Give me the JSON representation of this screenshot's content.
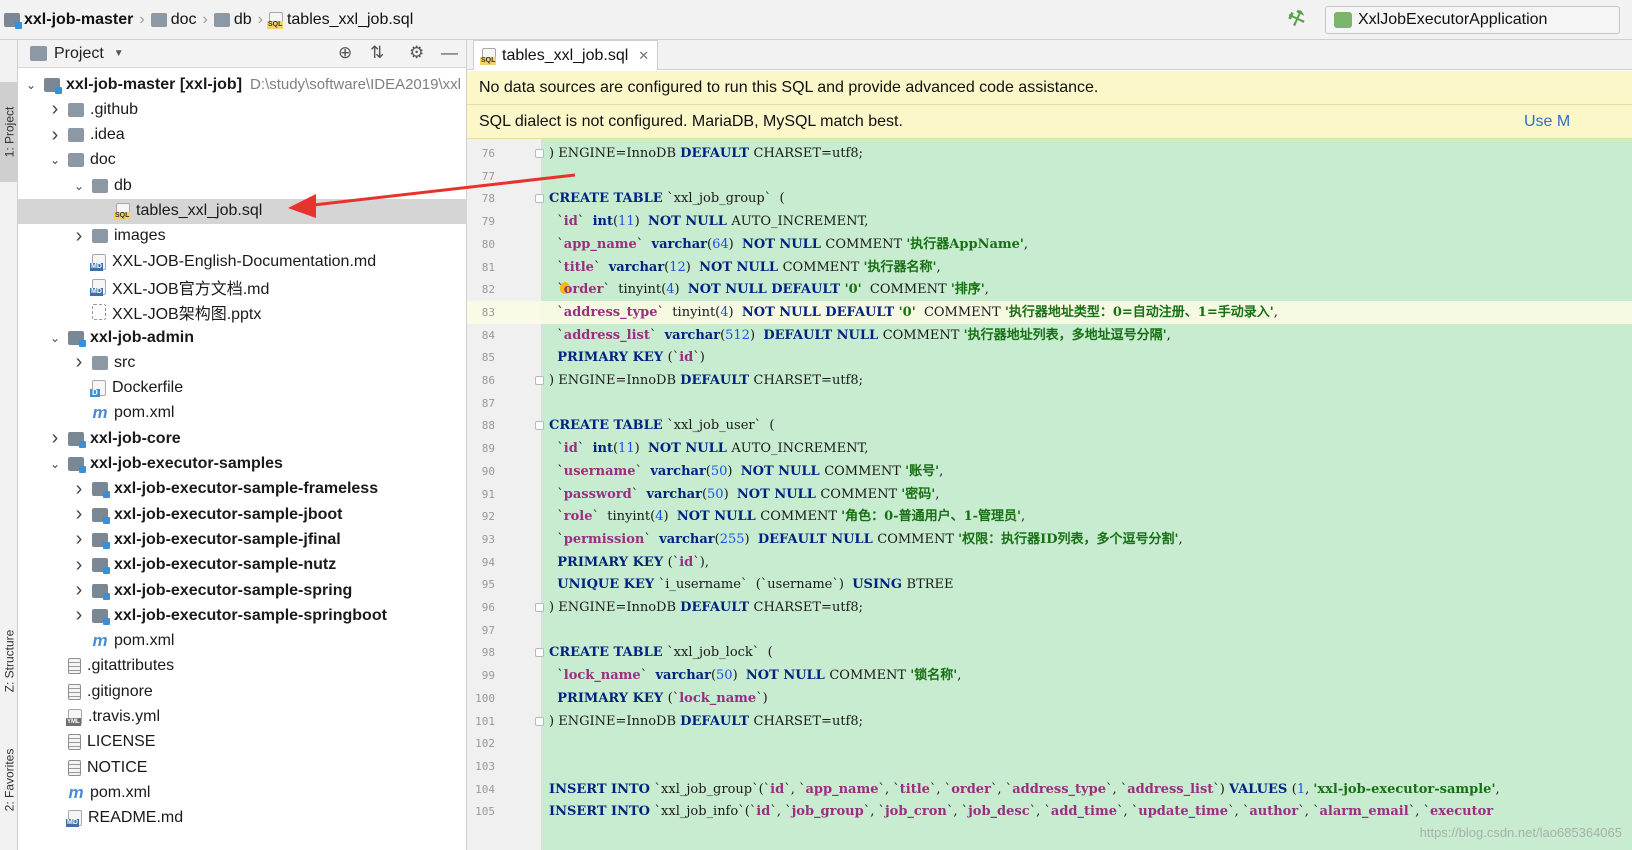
{
  "breadcrumb": [
    {
      "label": "xxl-job-master",
      "icon": "project-folder-icon",
      "bold": true
    },
    {
      "label": "doc",
      "icon": "folder-icon",
      "bold": false
    },
    {
      "label": "db",
      "icon": "folder-icon",
      "bold": false
    },
    {
      "label": "tables_xxl_job.sql",
      "icon": "sql-file-icon",
      "bold": false
    }
  ],
  "run_config": {
    "label": "XxlJobExecutorApplication",
    "icon": "spring-boot-run-icon"
  },
  "build_icon": "hammer-icon",
  "left_tool_tabs": [
    "1: Project",
    "Z: Structure",
    "2: Favorites"
  ],
  "project_panel": {
    "title": "Project"
  },
  "tree": [
    {
      "depth": 0,
      "arrow": "down",
      "icon": "folder mod",
      "label": "xxl-job-master [xxl-job]",
      "bold": true,
      "path": "D:\\study\\software\\IDEA2019\\xxl"
    },
    {
      "depth": 1,
      "arrow": "right",
      "icon": "folder",
      "label": ".github"
    },
    {
      "depth": 1,
      "arrow": "right",
      "icon": "folder",
      "label": ".idea"
    },
    {
      "depth": 1,
      "arrow": "down",
      "icon": "folder",
      "label": "doc"
    },
    {
      "depth": 2,
      "arrow": "down",
      "icon": "folder",
      "label": "db"
    },
    {
      "depth": 3,
      "arrow": "",
      "icon": "sql",
      "label": "tables_xxl_job.sql",
      "selected": true
    },
    {
      "depth": 2,
      "arrow": "right",
      "icon": "folder",
      "label": "images"
    },
    {
      "depth": 2,
      "arrow": "",
      "icon": "md",
      "label": "XXL-JOB-English-Documentation.md"
    },
    {
      "depth": 2,
      "arrow": "",
      "icon": "md",
      "label": "XXL-JOB官方文档.md"
    },
    {
      "depth": 2,
      "arrow": "",
      "icon": "ppt",
      "label": "XXL-JOB架构图.pptx"
    },
    {
      "depth": 1,
      "arrow": "down",
      "icon": "folder mod",
      "label": "xxl-job-admin",
      "bold": true
    },
    {
      "depth": 2,
      "arrow": "right",
      "icon": "folder",
      "label": "src"
    },
    {
      "depth": 2,
      "arrow": "",
      "icon": "docker",
      "label": "Dockerfile"
    },
    {
      "depth": 2,
      "arrow": "",
      "icon": "maven",
      "label": "pom.xml"
    },
    {
      "depth": 1,
      "arrow": "right",
      "icon": "folder mod",
      "label": "xxl-job-core",
      "bold": true
    },
    {
      "depth": 1,
      "arrow": "down",
      "icon": "folder mod",
      "label": "xxl-job-executor-samples",
      "bold": true
    },
    {
      "depth": 2,
      "arrow": "right",
      "icon": "folder mod",
      "label": "xxl-job-executor-sample-frameless",
      "bold": true
    },
    {
      "depth": 2,
      "arrow": "right",
      "icon": "folder mod",
      "label": "xxl-job-executor-sample-jboot",
      "bold": true
    },
    {
      "depth": 2,
      "arrow": "right",
      "icon": "folder mod",
      "label": "xxl-job-executor-sample-jfinal",
      "bold": true
    },
    {
      "depth": 2,
      "arrow": "right",
      "icon": "folder mod",
      "label": "xxl-job-executor-sample-nutz",
      "bold": true
    },
    {
      "depth": 2,
      "arrow": "right",
      "icon": "folder mod",
      "label": "xxl-job-executor-sample-spring",
      "bold": true
    },
    {
      "depth": 2,
      "arrow": "right",
      "icon": "folder mod",
      "label": "xxl-job-executor-sample-springboot",
      "bold": true
    },
    {
      "depth": 2,
      "arrow": "",
      "icon": "maven",
      "label": "pom.xml"
    },
    {
      "depth": 1,
      "arrow": "",
      "icon": "txt",
      "label": ".gitattributes"
    },
    {
      "depth": 1,
      "arrow": "",
      "icon": "txt",
      "label": ".gitignore"
    },
    {
      "depth": 1,
      "arrow": "",
      "icon": "yml",
      "label": ".travis.yml"
    },
    {
      "depth": 1,
      "arrow": "",
      "icon": "txt",
      "label": "LICENSE"
    },
    {
      "depth": 1,
      "arrow": "",
      "icon": "txt",
      "label": "NOTICE"
    },
    {
      "depth": 1,
      "arrow": "",
      "icon": "maven",
      "label": "pom.xml"
    },
    {
      "depth": 1,
      "arrow": "",
      "icon": "md",
      "label": "README.md"
    }
  ],
  "editor": {
    "tab_label": "tables_xxl_job.sql",
    "banner1": "No data sources are configured to run this SQL and provide advanced code assistance.",
    "banner2": "SQL dialect is not configured. MariaDB, MySQL match best.",
    "banner2_link": "Use M",
    "current_line": 83,
    "lines": [
      {
        "n": "76",
        "fold": true,
        "t": [
          [
            ") ENGINE=InnoDB ",
            ""
          ],
          [
            "DEFAULT ",
            "kw"
          ],
          [
            "CHARSET=utf8;",
            ""
          ]
        ]
      },
      {
        "n": "77",
        "t": []
      },
      {
        "n": "78",
        "fold": true,
        "t": [
          [
            "CREATE TABLE ",
            "kw"
          ],
          [
            "`xxl_job_group`  (",
            ""
          ]
        ]
      },
      {
        "n": "79",
        "t": [
          [
            "  `",
            ""
          ],
          [
            "id",
            "id"
          ],
          [
            "`  ",
            ""
          ],
          [
            "int",
            "kw"
          ],
          [
            "(",
            ""
          ],
          [
            "11",
            "num"
          ],
          [
            ")  ",
            ""
          ],
          [
            "NOT NULL ",
            "kw"
          ],
          [
            "AUTO_INCREMENT,",
            ""
          ]
        ]
      },
      {
        "n": "80",
        "t": [
          [
            "  `",
            ""
          ],
          [
            "app_name",
            "id"
          ],
          [
            "`  ",
            ""
          ],
          [
            "varchar",
            "kw"
          ],
          [
            "(",
            ""
          ],
          [
            "64",
            "num"
          ],
          [
            ")  ",
            ""
          ],
          [
            "NOT NULL ",
            "kw"
          ],
          [
            "COMMENT ",
            ""
          ],
          [
            "'执行器AppName'",
            "str"
          ],
          [
            ",",
            ""
          ]
        ]
      },
      {
        "n": "81",
        "t": [
          [
            "  `",
            ""
          ],
          [
            "title",
            "id"
          ],
          [
            "`  ",
            ""
          ],
          [
            "varchar",
            "kw"
          ],
          [
            "(",
            ""
          ],
          [
            "12",
            "num"
          ],
          [
            ")  ",
            ""
          ],
          [
            "NOT NULL ",
            "kw"
          ],
          [
            "COMMENT ",
            ""
          ],
          [
            "'执行器名称'",
            "str"
          ],
          [
            ",",
            ""
          ]
        ]
      },
      {
        "n": "82",
        "bulb": true,
        "t": [
          [
            "  `",
            ""
          ],
          [
            "order",
            "id"
          ],
          [
            "`  tinyint(",
            ""
          ],
          [
            "4",
            "num"
          ],
          [
            ")  ",
            ""
          ],
          [
            "NOT NULL DEFAULT ",
            "kw"
          ],
          [
            "'0'",
            "str"
          ],
          [
            "  COMMENT ",
            ""
          ],
          [
            "'排序'",
            "str"
          ],
          [
            ",",
            ""
          ]
        ]
      },
      {
        "n": "83",
        "t": [
          [
            "  `",
            ""
          ],
          [
            "address_type",
            "id"
          ],
          [
            "`  tinyint(",
            ""
          ],
          [
            "4",
            "num"
          ],
          [
            ")  ",
            ""
          ],
          [
            "NOT NULL DEFAULT ",
            "kw"
          ],
          [
            "'0'",
            "str"
          ],
          [
            "  COMMENT ",
            ""
          ],
          [
            "'执行器地址类型：0=自动注册、1=手动录入'",
            "str"
          ],
          [
            ",",
            ""
          ]
        ]
      },
      {
        "n": "84",
        "t": [
          [
            "  `",
            ""
          ],
          [
            "address_list",
            "id"
          ],
          [
            "`  ",
            ""
          ],
          [
            "varchar",
            "kw"
          ],
          [
            "(",
            ""
          ],
          [
            "512",
            "num"
          ],
          [
            ")  ",
            ""
          ],
          [
            "DEFAULT NULL ",
            "kw"
          ],
          [
            "COMMENT ",
            ""
          ],
          [
            "'执行器地址列表，多地址逗号分隔'",
            "str"
          ],
          [
            ",",
            ""
          ]
        ]
      },
      {
        "n": "85",
        "t": [
          [
            "  ",
            ""
          ],
          [
            "PRIMARY KEY ",
            "kw"
          ],
          [
            "(`",
            ""
          ],
          [
            "id",
            "id"
          ],
          [
            "`)",
            ""
          ]
        ]
      },
      {
        "n": "86",
        "fold": true,
        "t": [
          [
            ") ENGINE=InnoDB ",
            ""
          ],
          [
            "DEFAULT ",
            "kw"
          ],
          [
            "CHARSET=utf8;",
            ""
          ]
        ]
      },
      {
        "n": "87",
        "t": []
      },
      {
        "n": "88",
        "fold": true,
        "t": [
          [
            "CREATE TABLE ",
            "kw"
          ],
          [
            "`xxl_job_user`  (",
            ""
          ]
        ]
      },
      {
        "n": "89",
        "t": [
          [
            "  `",
            ""
          ],
          [
            "id",
            "id"
          ],
          [
            "`  ",
            ""
          ],
          [
            "int",
            "kw"
          ],
          [
            "(",
            ""
          ],
          [
            "11",
            "num"
          ],
          [
            ")  ",
            ""
          ],
          [
            "NOT NULL ",
            "kw"
          ],
          [
            "AUTO_INCREMENT,",
            ""
          ]
        ]
      },
      {
        "n": "90",
        "t": [
          [
            "  `",
            ""
          ],
          [
            "username",
            "id"
          ],
          [
            "`  ",
            ""
          ],
          [
            "varchar",
            "kw"
          ],
          [
            "(",
            ""
          ],
          [
            "50",
            "num"
          ],
          [
            ")  ",
            ""
          ],
          [
            "NOT NULL ",
            "kw"
          ],
          [
            "COMMENT ",
            ""
          ],
          [
            "'账号'",
            "str"
          ],
          [
            ",",
            ""
          ]
        ]
      },
      {
        "n": "91",
        "t": [
          [
            "  `",
            ""
          ],
          [
            "password",
            "id"
          ],
          [
            "`  ",
            ""
          ],
          [
            "varchar",
            "kw"
          ],
          [
            "(",
            ""
          ],
          [
            "50",
            "num"
          ],
          [
            ")  ",
            ""
          ],
          [
            "NOT NULL ",
            "kw"
          ],
          [
            "COMMENT ",
            ""
          ],
          [
            "'密码'",
            "str"
          ],
          [
            ",",
            ""
          ]
        ]
      },
      {
        "n": "92",
        "t": [
          [
            "  `",
            ""
          ],
          [
            "role",
            "id"
          ],
          [
            "`  tinyint(",
            ""
          ],
          [
            "4",
            "num"
          ],
          [
            ")  ",
            ""
          ],
          [
            "NOT NULL ",
            "kw"
          ],
          [
            "COMMENT ",
            ""
          ],
          [
            "'角色：0-普通用户、1-管理员'",
            "str"
          ],
          [
            ",",
            ""
          ]
        ]
      },
      {
        "n": "93",
        "t": [
          [
            "  `",
            ""
          ],
          [
            "permission",
            "id"
          ],
          [
            "`  ",
            ""
          ],
          [
            "varchar",
            "kw"
          ],
          [
            "(",
            ""
          ],
          [
            "255",
            "num"
          ],
          [
            ")  ",
            ""
          ],
          [
            "DEFAULT NULL ",
            "kw"
          ],
          [
            "COMMENT ",
            ""
          ],
          [
            "'权限：执行器ID列表，多个逗号分割'",
            "str"
          ],
          [
            ",",
            ""
          ]
        ]
      },
      {
        "n": "94",
        "t": [
          [
            "  ",
            ""
          ],
          [
            "PRIMARY KEY ",
            "kw"
          ],
          [
            "(`",
            ""
          ],
          [
            "id",
            "id"
          ],
          [
            "`),",
            ""
          ]
        ]
      },
      {
        "n": "95",
        "t": [
          [
            "  ",
            ""
          ],
          [
            "UNIQUE KEY ",
            "kw"
          ],
          [
            "`i_username`  (`username`)  ",
            ""
          ],
          [
            "USING ",
            "kw"
          ],
          [
            "BTREE",
            ""
          ]
        ]
      },
      {
        "n": "96",
        "fold": true,
        "t": [
          [
            ") ENGINE=InnoDB ",
            ""
          ],
          [
            "DEFAULT ",
            "kw"
          ],
          [
            "CHARSET=utf8;",
            ""
          ]
        ]
      },
      {
        "n": "97",
        "t": []
      },
      {
        "n": "98",
        "fold": true,
        "t": [
          [
            "CREATE TABLE ",
            "kw"
          ],
          [
            "`xxl_job_lock`  (",
            ""
          ]
        ]
      },
      {
        "n": "99",
        "t": [
          [
            "  `",
            ""
          ],
          [
            "lock_name",
            "id"
          ],
          [
            "`  ",
            ""
          ],
          [
            "varchar",
            "kw"
          ],
          [
            "(",
            ""
          ],
          [
            "50",
            "num"
          ],
          [
            ")  ",
            ""
          ],
          [
            "NOT NULL ",
            "kw"
          ],
          [
            "COMMENT ",
            ""
          ],
          [
            "'锁名称'",
            "str"
          ],
          [
            ",",
            ""
          ]
        ]
      },
      {
        "n": "100",
        "t": [
          [
            "  ",
            ""
          ],
          [
            "PRIMARY KEY ",
            "kw"
          ],
          [
            "(`",
            ""
          ],
          [
            "lock_name",
            "id"
          ],
          [
            "`)",
            ""
          ]
        ]
      },
      {
        "n": "101",
        "fold": true,
        "t": [
          [
            ") ENGINE=InnoDB ",
            ""
          ],
          [
            "DEFAULT ",
            "kw"
          ],
          [
            "CHARSET=utf8;",
            ""
          ]
        ]
      },
      {
        "n": "102",
        "t": []
      },
      {
        "n": "103",
        "t": []
      },
      {
        "n": "104",
        "t": [
          [
            "INSERT INTO ",
            "kw"
          ],
          [
            "`xxl_job_group`(`",
            ""
          ],
          [
            "id",
            "id"
          ],
          [
            "`, `",
            ""
          ],
          [
            "app_name",
            "id"
          ],
          [
            "`, `",
            ""
          ],
          [
            "title",
            "id"
          ],
          [
            "`, `",
            ""
          ],
          [
            "order",
            "id"
          ],
          [
            "`, `",
            ""
          ],
          [
            "address_type",
            "id"
          ],
          [
            "`, `",
            ""
          ],
          [
            "address_list",
            "id"
          ],
          [
            "`) ",
            ""
          ],
          [
            "VALUES ",
            "kw"
          ],
          [
            "(",
            ""
          ],
          [
            "1",
            "num"
          ],
          [
            ", ",
            ""
          ],
          [
            "'xxl-job-executor-sample'",
            "str"
          ],
          [
            ",",
            ""
          ]
        ]
      },
      {
        "n": "105",
        "t": [
          [
            "INSERT INTO ",
            "kw"
          ],
          [
            "`xxl_job_info`(`",
            ""
          ],
          [
            "id",
            "id"
          ],
          [
            "`, `",
            ""
          ],
          [
            "job_group",
            "id"
          ],
          [
            "`, `",
            ""
          ],
          [
            "job_cron",
            "id"
          ],
          [
            "`, `",
            ""
          ],
          [
            "job_desc",
            "id"
          ],
          [
            "`, `",
            ""
          ],
          [
            "add_time",
            "id"
          ],
          [
            "`, `",
            ""
          ],
          [
            "update_time",
            "id"
          ],
          [
            "`, `",
            ""
          ],
          [
            "author",
            "id"
          ],
          [
            "`, `",
            ""
          ],
          [
            "alarm_email",
            "id"
          ],
          [
            "`, `",
            ""
          ],
          [
            "executor",
            "id"
          ]
        ]
      }
    ]
  },
  "watermark": "https://blog.csdn.net/lao685364065",
  "colors": {
    "annotation_arrow": "#e8322d",
    "code_background": "#c8ecd0",
    "banner": "#fbf7c8"
  }
}
